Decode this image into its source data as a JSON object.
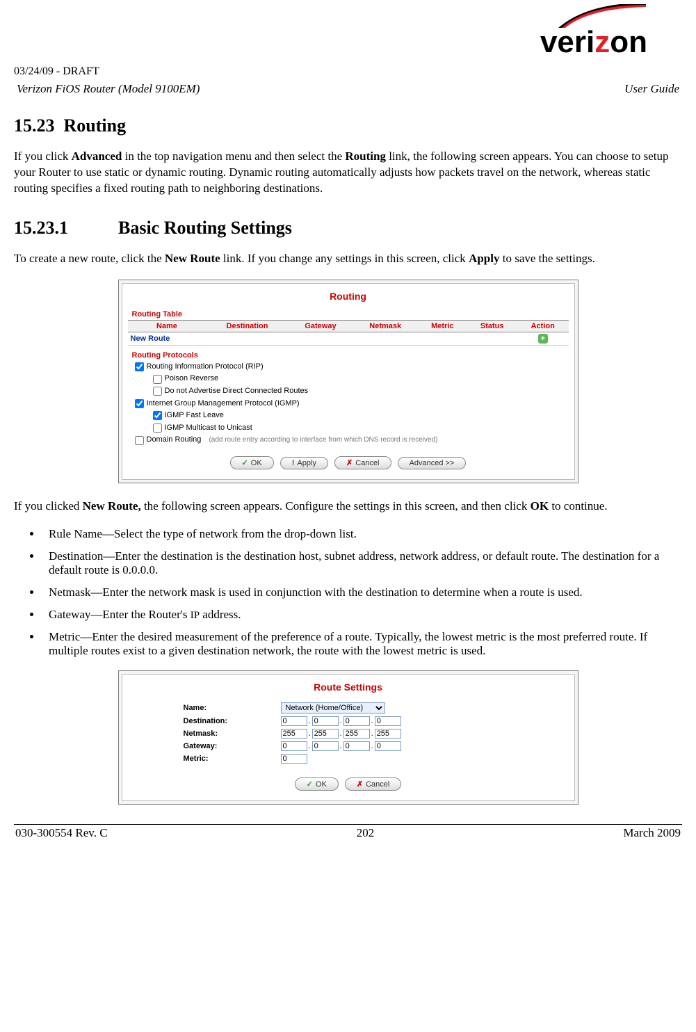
{
  "header": {
    "draft": "03/24/09 - DRAFT",
    "product": "Verizon FiOS Router (Model 9100EM)",
    "doc_type": "User Guide",
    "logo_text_left": "veri",
    "logo_text_z": "z",
    "logo_text_right": "on"
  },
  "section": {
    "number": "15.23",
    "title": "Routing",
    "intro": "If you click Advanced in the top navigation menu and then select the Routing link, the following screen appears. You can choose to setup your Router to use static or dynamic routing. Dynamic routing automatically adjusts how packets travel on the network, whereas static routing specifies a fixed routing path to neighboring destinations."
  },
  "subsection": {
    "number": "15.23.1",
    "title": "Basic Routing Settings",
    "intro": "To create a new route, click the New Route link. If you change any settings in this screen, click Apply to save the settings.",
    "after_fig1": "If you clicked New Route, the following screen appears. Configure the settings in this screen, and then click OK to continue.",
    "bullets": [
      "Rule Name—Select the type of network from the drop-down list.",
      "Destination—Enter the destination is the destination host, subnet address, network address, or default route. The destination for a default route is 0.0.0.0.",
      "Netmask—Enter the network mask is used in conjunction with the destination to determine when a route is used.",
      "Gateway—Enter the Router's IP address.",
      "Metric—Enter the desired measurement of the preference of a route. Typically, the lowest metric is the most preferred route. If multiple routes exist to a given destination network, the route with the lowest metric is used."
    ]
  },
  "fig1": {
    "title": "Routing",
    "routing_table_heading": "Routing Table",
    "columns": [
      "Name",
      "Destination",
      "Gateway",
      "Netmask",
      "Metric",
      "Status",
      "Action"
    ],
    "new_route": "New Route",
    "protocols_heading": "Routing Protocols",
    "protocols": {
      "rip": {
        "label": "Routing Information Protocol (RIP)",
        "checked": true
      },
      "poison": {
        "label": "Poison Reverse",
        "checked": false
      },
      "dnac": {
        "label": "Do not Advertise Direct Connected Routes",
        "checked": false
      },
      "igmp": {
        "label": "Internet Group Management Protocol (IGMP)",
        "checked": true
      },
      "fastleave": {
        "label": "IGMP Fast Leave",
        "checked": true
      },
      "mc2uc": {
        "label": "IGMP Multicast to Unicast",
        "checked": false
      },
      "domain": {
        "label": "Domain Routing",
        "checked": false,
        "hint": "(add route entry according to interface from which DNS record is received)"
      }
    },
    "buttons": {
      "ok": "OK",
      "apply": "Apply",
      "cancel": "Cancel",
      "advanced": "Advanced >>"
    }
  },
  "fig2": {
    "title": "Route Settings",
    "labels": {
      "name": "Name:",
      "destination": "Destination:",
      "netmask": "Netmask:",
      "gateway": "Gateway:",
      "metric": "Metric:"
    },
    "name_value": "Network (Home/Office)",
    "destination": [
      "0",
      "0",
      "0",
      "0"
    ],
    "netmask": [
      "255",
      "255",
      "255",
      "255"
    ],
    "gateway": [
      "0",
      "0",
      "0",
      "0"
    ],
    "metric": "0",
    "buttons": {
      "ok": "OK",
      "cancel": "Cancel"
    }
  },
  "footer": {
    "left": "030-300554 Rev. C",
    "center": "202",
    "right": "March 2009"
  }
}
